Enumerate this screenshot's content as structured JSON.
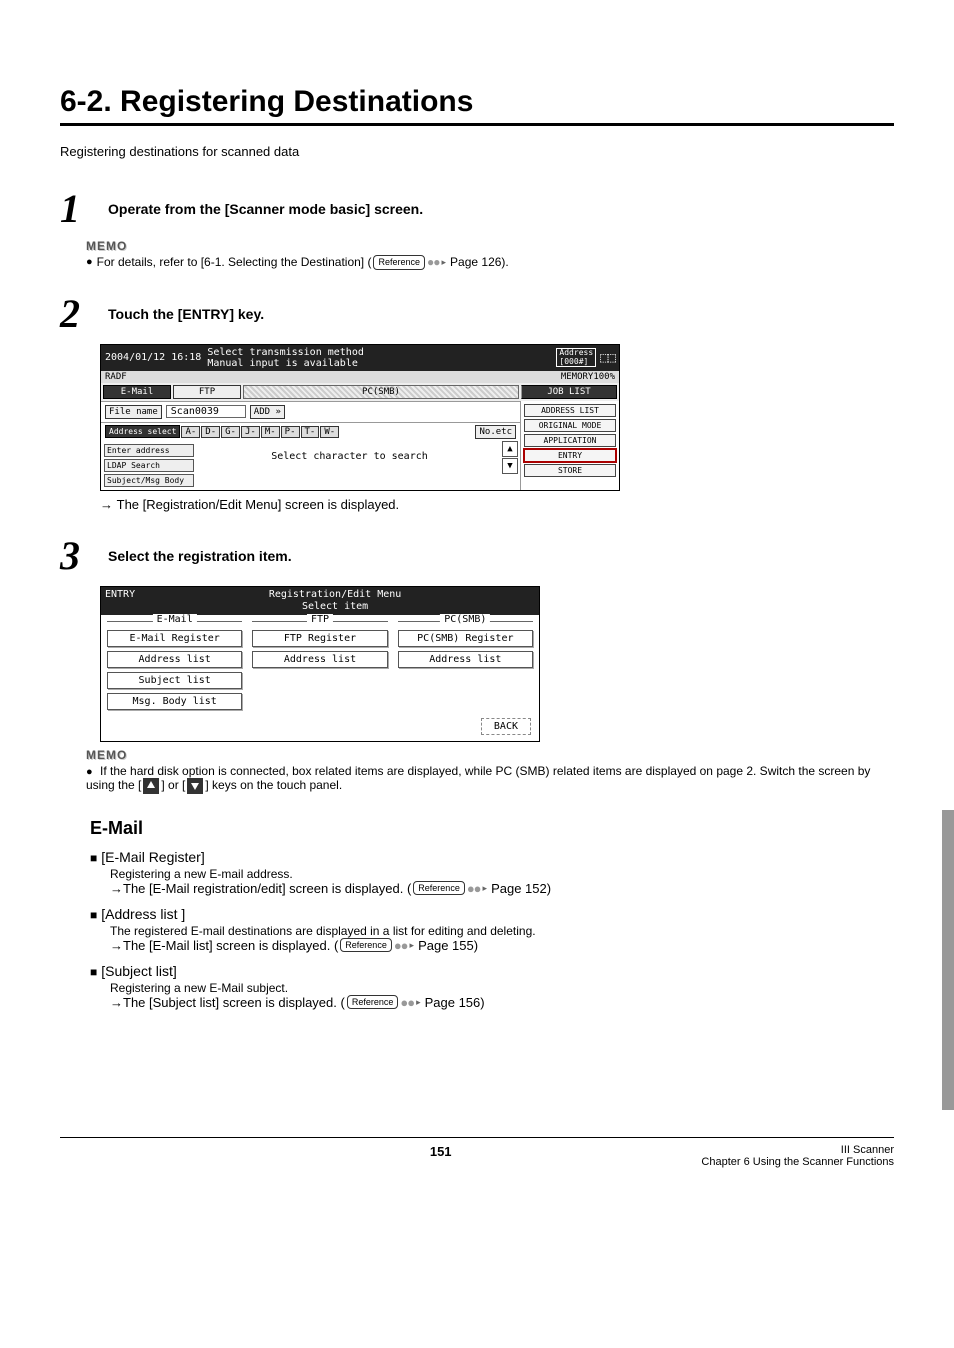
{
  "title": "6-2. Registering Destinations",
  "lead": "Registering destinations for scanned data",
  "steps": {
    "s1": {
      "num": "1",
      "title": "Operate from the [Scanner mode basic] screen.",
      "memo_label": "MEMO",
      "memo_text_a": "For details, refer to [6-1. Selecting the Destination] (",
      "ref": "Reference",
      "memo_text_b": " Page 126)."
    },
    "s2": {
      "num": "2",
      "title": "Touch the [ENTRY] key.",
      "result": "The [Registration/Edit Menu] screen is displayed."
    },
    "s3": {
      "num": "3",
      "title": "Select the registration item.",
      "memo_label": "MEMO",
      "memo_text_a": "If the hard disk option is connected, box related items are displayed, while PC (SMB) related items are displayed on page 2. Switch the screen by using the [",
      "memo_text_b": "] or [",
      "memo_text_c": "] keys on the touch panel."
    }
  },
  "screen1": {
    "datetime": "2004/01/12 16:18",
    "message_l1": "Select transmission method",
    "message_l2": "Manual input is available",
    "radf": "RADF",
    "address_box_l1": "Address",
    "address_box_l2": "[000#]",
    "memory": "MEMORY100%",
    "tab_email": "E-Mail",
    "tab_ftp": "FTP",
    "tab_pcsmb": "PC(SMB)",
    "joblist": "JOB LIST",
    "file_name_label": "File name",
    "file_name_value": "Scan0039",
    "add_btn": "ADD »",
    "address_list": "ADDRESS LIST",
    "address_select": "Address select",
    "letter_a": "A-",
    "letter_d": "D-",
    "letter_g": "G-",
    "letter_j": "J-",
    "letter_m": "M-",
    "letter_p": "P-",
    "letter_t": "T-",
    "letter_w": "W-",
    "no_etc": "No.etc",
    "original_mode": "ORIGINAL MODE",
    "enter_address": "Enter address",
    "ldap_search": "LDAP Search",
    "subject_msg_body": "Subject/Msg Body",
    "select_char": "Select character to search",
    "application": "APPLICATION",
    "entry": "ENTRY",
    "store": "STORE"
  },
  "screen2": {
    "mode_label": "ENTRY",
    "header_l1": "Registration/Edit Menu",
    "header_l2": "Select item",
    "grp_email": "E-Mail",
    "grp_ftp": "FTP",
    "grp_pcsmb": "PC(SMB)",
    "email_reg": "E-Mail Register",
    "ftp_reg": "FTP Register",
    "pcsmb_reg": "PC(SMB) Register",
    "addr_list": "Address list",
    "subject_list": "Subject list",
    "msg_body_list": "Msg. Body list",
    "back": "BACK"
  },
  "email_section": {
    "heading": "E-Mail",
    "item1": {
      "head": "[E-Mail Register]",
      "desc": "Registering a new E-mail address.",
      "res_a": "The [E-Mail registration/edit] screen is displayed. (",
      "ref": "Reference",
      "res_b": " Page 152)"
    },
    "item2": {
      "head": "[Address list ]",
      "desc": "The registered E-mail destinations are displayed in a list for editing and deleting.",
      "res_a": "The [E-Mail list] screen is displayed. (",
      "ref": "Reference",
      "res_b": " Page 155)"
    },
    "item3": {
      "head": "[Subject list]",
      "desc": "Registering a new E-Mail subject.",
      "res_a": "The [Subject list] screen is displayed. (",
      "ref": "Reference",
      "res_b": " Page 156)"
    }
  },
  "footer": {
    "page_num": "151",
    "right_l1": "III Scanner",
    "right_l2": "Chapter 6 Using the Scanner Functions"
  }
}
